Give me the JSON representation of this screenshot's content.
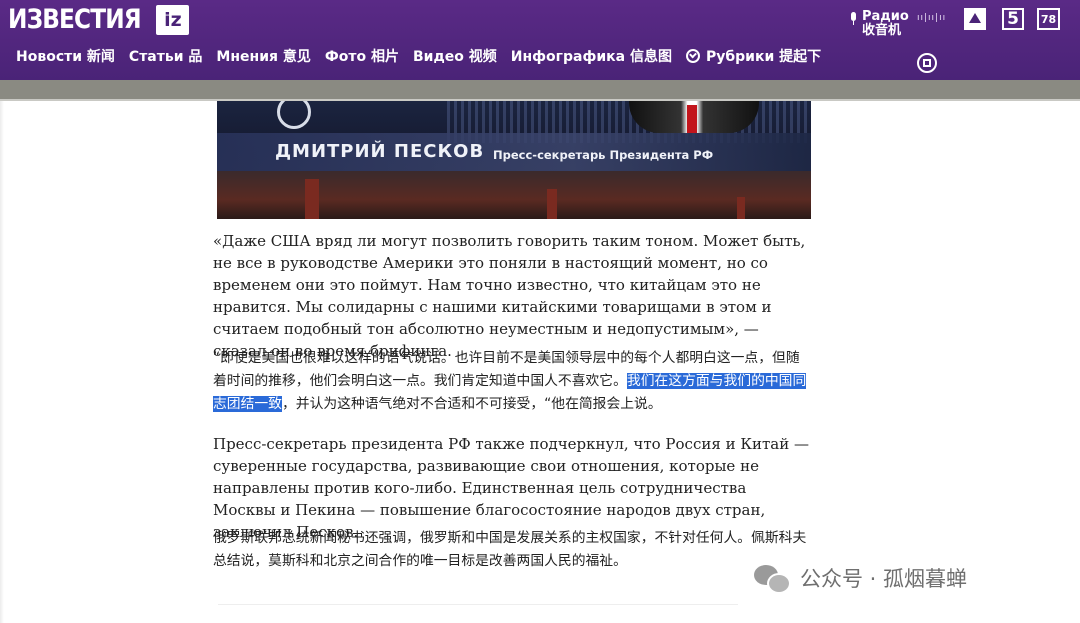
{
  "header": {
    "logo_text": "ИЗВЕСТИЯ",
    "logo_badge": "iz",
    "nav": [
      {
        "label": "Новости 新闻"
      },
      {
        "label": "Статьи 品"
      },
      {
        "label": "Мнения 意见"
      },
      {
        "label": "Фото 相片"
      },
      {
        "label": "Видео 视频"
      },
      {
        "label": "Инфографика 信息图"
      },
      {
        "label": "Рубрики 提起下",
        "icon": "check-circle-icon"
      }
    ],
    "radio_label": "Радио 收音机",
    "eq_text": "ıı|ıı|ıı",
    "tv_channels": [
      "ren-tv-icon",
      "5",
      "78"
    ],
    "extra_icon": "channel-logo-icon",
    "brand_color": "#4a2377"
  },
  "video": {
    "name": "ДМИТРИЙ ПЕСКОВ",
    "role": "Пресс-секретарь Президента РФ"
  },
  "article": {
    "p1_ru": "«Даже США вряд ли могут позволить говорить таким тоном. Может быть, не все в руководстве Америки это поняли в настоящий момент, но со временем они это поймут. Нам точно известно, что китайцам это не нравится. Мы солидарны с нашими китайскими товарищами в этом и считаем подобный тон абсолютно неуместным и недопустимым», — сказал он во время брифинга.",
    "p1_zh_before": "“即使是美国也很难以这样的语气说话。也许目前不是美国领导层中的每个人都明白这一点，但随着时间的推移，他们会明白这一点。我们肯定知道中国人不喜欢它。",
    "p1_zh_highlight": "我们在这方面与我们的中国同志团结一致",
    "p1_zh_after": "，并认为这种语气绝对不合适和不可接受，“他在简报会上说。",
    "p2_ru": "Пресс-секретарь президента РФ также подчеркнул, что Россия и Китай — суверенные государства, развивающие свои отношения, которые не направлены против кого-либо. Единственная цель сотрудничества Москвы и Пекина — повышение благосостояние народов двух стран, заключил Песков.",
    "p2_zh": "俄罗斯联邦总统新闻秘书还强调，俄罗斯和中国是发展关系的主权国家，不针对任何人。佩斯科夫总结说，莫斯科和北京之间合作的唯一目标是改善两国人民的福祉。"
  },
  "watermark": {
    "text": "公众号 · 孤烟暮蝉",
    "icon": "wechat-icon"
  }
}
